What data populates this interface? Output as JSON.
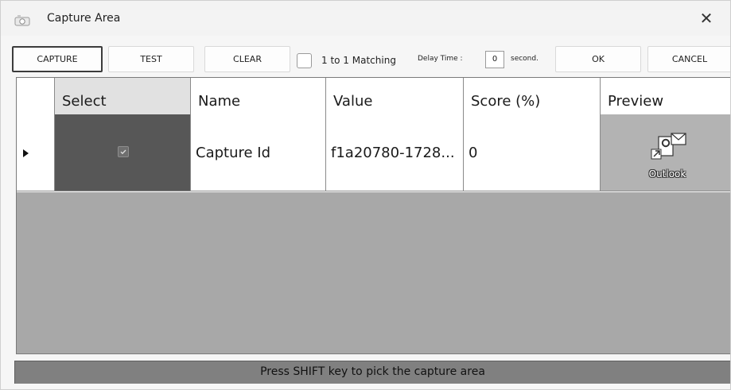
{
  "window": {
    "title": "Capture Area",
    "close_glyph": "✕"
  },
  "toolbar": {
    "capture_label": "CAPTURE",
    "test_label": "TEST",
    "clear_label": "CLEAR",
    "matching_label": "1 to 1 Matching",
    "matching_checked": false,
    "delay_label": "Delay Time :",
    "delay_value": "0",
    "second_label": "second.",
    "ok_label": "OK",
    "cancel_label": "CANCEL"
  },
  "grid": {
    "columns": [
      "Select",
      "Name",
      "Value",
      "Score (%)",
      "Preview"
    ],
    "rows": [
      {
        "selected": true,
        "name": "Capture Id",
        "value": "f1a20780-1728...",
        "score": "0",
        "preview_label": "Outlook"
      }
    ]
  },
  "status": {
    "message": "Press SHIFT key to pick the capture area"
  },
  "colors": {
    "select_cell": "#575757",
    "grid_empty": "#a8a8a8",
    "status_bar": "#808080",
    "outlook_blue": "#0f6cbd"
  },
  "icons": {
    "app": "camera-icon",
    "close": "close-icon",
    "row_indicator": "triangle-right-icon",
    "preview": "outlook-icon"
  }
}
